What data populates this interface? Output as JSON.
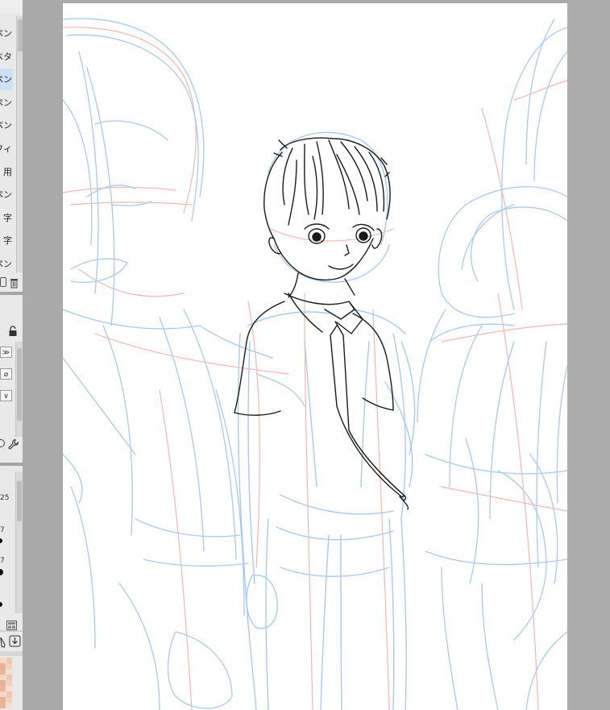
{
  "brush_list": {
    "items": [
      {
        "label": "ペン"
      },
      {
        "label": "ベタ"
      },
      {
        "label": "ペン",
        "selected": true
      },
      {
        "label": "ペン"
      },
      {
        "label": "ペン"
      },
      {
        "label": "フィ"
      },
      {
        "label": "用"
      },
      {
        "label": "ペン"
      },
      {
        "label": "字"
      },
      {
        "label": "字"
      },
      {
        "label": "ペン"
      }
    ],
    "actions": [
      {
        "icon": "copy-icon"
      },
      {
        "icon": "trash-icon"
      }
    ]
  },
  "tool_property": {
    "lock_icon": "lock-icon",
    "buttons": [
      {
        "icon": "double-chevron-down-icon",
        "glyph": "≫"
      },
      {
        "icon": "no-entry-icon",
        "glyph": "⌀"
      },
      {
        "icon": "chevron-down-icon",
        "glyph": "∨"
      }
    ],
    "bottom_icons": [
      {
        "icon": "circle-icon"
      },
      {
        "icon": "wrench-icon"
      }
    ]
  },
  "brush_size": {
    "entries": [
      {
        "value": "25"
      },
      {
        "value": "7"
      },
      {
        "value": "7"
      }
    ]
  },
  "bottom_tools": {
    "icons": [
      {
        "icon": "layout-icon"
      },
      {
        "icon": "pen-tool-icon"
      },
      {
        "icon": "import-icon"
      }
    ]
  },
  "colors": {
    "canvas_bg": "#ffffff",
    "workspace_gray": "#a9a9a9",
    "sketch_blue": "#a9c9ee",
    "sketch_red": "#f2b7b3",
    "ink_black": "#1a1a1a",
    "selection_blue": "#cfe0f4",
    "skin_palette": [
      "#f6d7c6",
      "#f1c6ae",
      "#e9b195",
      "#f4cfb8",
      "#eab79c",
      "#f7dfd0"
    ]
  }
}
